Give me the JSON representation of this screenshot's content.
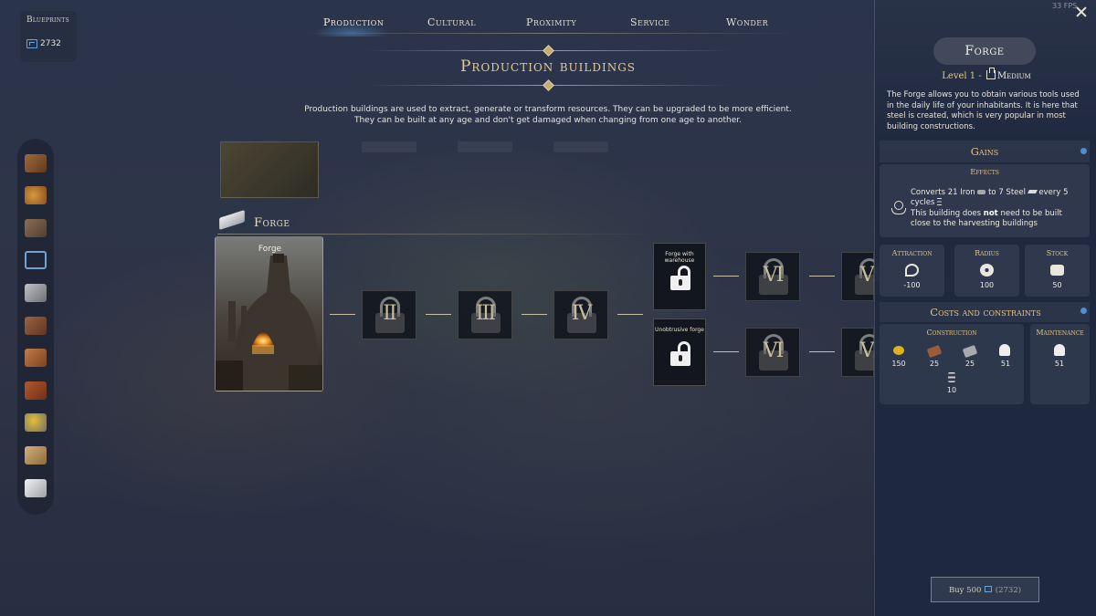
{
  "fps": "33 FPS",
  "blueprints": {
    "title": "Blueprints",
    "value": "2732",
    "icon": "blueprint-icon"
  },
  "tabs": [
    {
      "label": "Production",
      "active": true
    },
    {
      "label": "Cultural",
      "active": false
    },
    {
      "label": "Proximity",
      "active": false
    },
    {
      "label": "Service",
      "active": false
    },
    {
      "label": "Wonder",
      "active": false
    }
  ],
  "page": {
    "title": "Production buildings",
    "description_line1": "Production buildings are used to extract, generate or transform resources. They can be upgraded to be more efficient.",
    "description_line2": "They can be built at any age and don't get damaged when changing from one age to another."
  },
  "sidebar_icons": [
    "wood-icon",
    "food-icon",
    "ore-icon",
    "blueprint-grid-icon",
    "iron-icon",
    "plank-icon",
    "copper-icon",
    "brick-icon",
    "gold-ore-icon",
    "parchment-icon",
    "steel-icon"
  ],
  "section": {
    "title": "Forge",
    "icon": "steel-ingot-icon"
  },
  "tree": {
    "base_card": "Forge",
    "levels": [
      "II",
      "III",
      "IV"
    ],
    "branch_a": {
      "label": "Forge with warehouse",
      "next": [
        "VI",
        "VI"
      ]
    },
    "branch_b": {
      "label": "Unobtrusive forge",
      "next": [
        "VI",
        "VI"
      ]
    }
  },
  "panel": {
    "name": "Forge",
    "level": "Level 1",
    "separator": "-",
    "size": "Medium",
    "description": "The Forge allows you to obtain various tools used in the daily life of your inhabitants. It is here that steel is created, which is very popular in most building constructions.",
    "gains_title": "Gains",
    "effects_label": "Effects",
    "effect": {
      "converts": "Converts 21 Iron",
      "to": "to 7 Steel",
      "every": "every 5 cycles",
      "note_pre": "This building does",
      "note_bold": "not",
      "note_post": "need to be built close to the harvesting buildings"
    },
    "stats": [
      {
        "label": "Attraction",
        "value": "-100",
        "icon": "attraction-icon"
      },
      {
        "label": "Radius",
        "value": "100",
        "icon": "radius-icon"
      },
      {
        "label": "Stock",
        "value": "50",
        "icon": "stock-icon"
      }
    ],
    "costs_title": "Costs and constraints",
    "construction_label": "Construction",
    "maintenance_label": "Maintenance",
    "construction": [
      {
        "icon": "gold-icon",
        "value": "150",
        "color": "#e0b31e"
      },
      {
        "icon": "plank-icon",
        "value": "25",
        "color": "#9a5c3a"
      },
      {
        "icon": "iron-icon",
        "value": "25",
        "color": "#a7a9ad"
      },
      {
        "icon": "worker-icon",
        "value": "51",
        "color": "#eeeeee"
      },
      {
        "icon": "hourglass-icon",
        "value": "10",
        "color": "#dddddd"
      }
    ],
    "maintenance": [
      {
        "icon": "worker-icon",
        "value": "51",
        "color": "#eeeeee"
      }
    ],
    "buy_button": {
      "prefix": "Buy 500",
      "suffix": "(2732)"
    }
  }
}
